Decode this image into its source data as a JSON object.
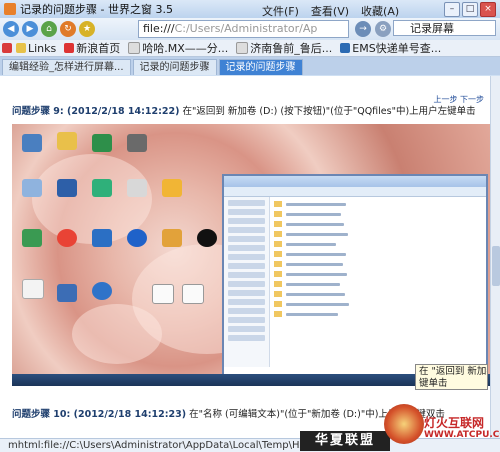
{
  "window": {
    "title": "记录的问题步骤 - 世界之窗 3.5"
  },
  "menus": [
    "文件(F)",
    "查看(V)",
    "收藏(A)"
  ],
  "address": {
    "prefix": "file:///",
    "path": "C:/Users/Administrator/Ap"
  },
  "search": {
    "value": "记录屏幕"
  },
  "favorites": [
    "Links",
    "新浪首页",
    "哈哈.MX——分...",
    "济南鲁前_鲁后...",
    "EMS快递单号查..."
  ],
  "tabs": [
    {
      "label": "编辑经验_怎样进行屏幕...",
      "active": false
    },
    {
      "label": "记录的问题步骤",
      "active": false
    },
    {
      "label": "记录的问题步骤",
      "active": true
    }
  ],
  "content": {
    "prev_next": "上一步 下一步",
    "step9": {
      "label": "问题步骤 9: (2012/2/18 14:12:22)",
      "text": "在\"返回到 新加卷 (D:) (按下按钮)\"(位于\"QQfiles\"中)上用户左键单击"
    },
    "step10": {
      "label": "问题步骤 10: (2012/2/18 14:12:23)",
      "text": "在\"名称 (可编辑文本)\"(位于\"新加卷 (D:)\"中)上用户左键双击"
    }
  },
  "tooltip": {
    "line1": "在 \"返回到 新加卷 (",
    "line2": "键单击"
  },
  "statusbar": {
    "text": "mhtml:file://C:\\Users\\Administrator\\AppData\\Local\\Temp\\HZ$D.Z"
  },
  "watermark": {
    "brand": "华夏联盟",
    "name": "灯火互联网",
    "url": "WWW.ATCPU.COM"
  },
  "colors": {
    "active_tab": "#3f82d4",
    "watermark_red": "#c62828"
  }
}
